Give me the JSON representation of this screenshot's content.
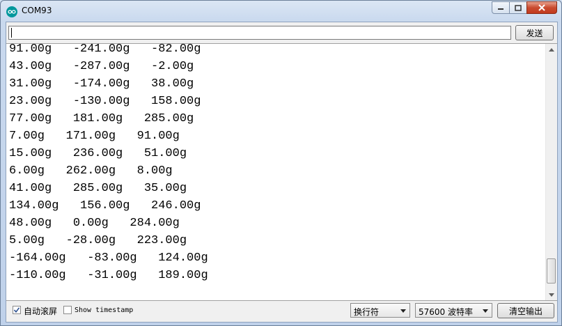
{
  "window": {
    "title": "COM93"
  },
  "input": {
    "value": "",
    "placeholder": "",
    "send_label": "发送"
  },
  "output": {
    "lines": [
      "91.00g   -241.00g   -82.00g",
      "43.00g   -287.00g   -2.00g",
      "31.00g   -174.00g   38.00g",
      "23.00g   -130.00g   158.00g",
      "77.00g   181.00g   285.00g",
      "7.00g   171.00g   91.00g",
      "15.00g   236.00g   51.00g",
      "6.00g   262.00g   8.00g",
      "41.00g   285.00g   35.00g",
      "134.00g   156.00g   246.00g",
      "48.00g   0.00g   284.00g",
      "5.00g   -28.00g   223.00g",
      "-164.00g   -83.00g   124.00g",
      "-110.00g   -31.00g   189.00g"
    ]
  },
  "bottom": {
    "autoscroll_label": "自动滚屏",
    "autoscroll_checked": true,
    "timestamp_label": "Show timestamp",
    "timestamp_checked": false,
    "line_ending": "换行符",
    "baud": "57600 波特率",
    "clear_label": "清空输出"
  },
  "colors": {
    "app_icon": "#00979c",
    "close_button": "#c94b2f"
  }
}
